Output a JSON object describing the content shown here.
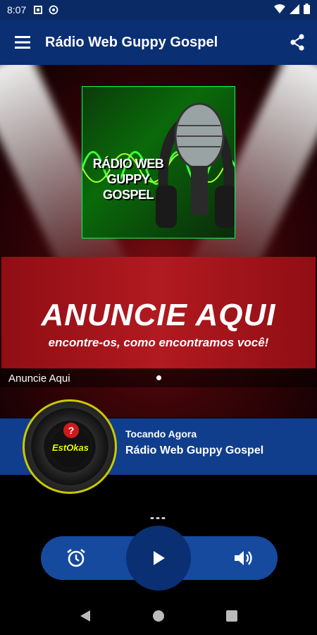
{
  "status_bar": {
    "time": "8:07",
    "icons": [
      "square-app-icon",
      "at-sign-icon"
    ],
    "right_icons": [
      "wifi-icon",
      "signal-icon",
      "battery-icon"
    ]
  },
  "app_bar": {
    "title": "Rádio Web Guppy Gospel",
    "menu_icon": "hamburger-menu-icon",
    "share_icon": "share-icon"
  },
  "cover": {
    "line1": "RÁDIO WEB",
    "line2": "GUPPY GOSPEL"
  },
  "banner": {
    "headline": "ANUNCIE AQUI",
    "tagline": "encontre-os, como encontramos você!",
    "caption": "Anuncie Aqui"
  },
  "now_playing": {
    "label": "Tocando Agora",
    "station": "Rádio Web Guppy Gospel",
    "disc_logo_text": "EstOkas",
    "disc_badge": "?"
  },
  "player": {
    "metadata": "---",
    "buttons": [
      "alarm-icon",
      "play-icon",
      "volume-icon"
    ]
  },
  "nav": {
    "buttons": [
      "back-icon",
      "home-icon",
      "recents-icon"
    ]
  },
  "colors": {
    "status_bar": "#0a2a66",
    "app_bar": "#0b2f73",
    "now_playing": "#103e8c",
    "control_pill": "#154a9f",
    "banner_red": "#b11a20"
  }
}
